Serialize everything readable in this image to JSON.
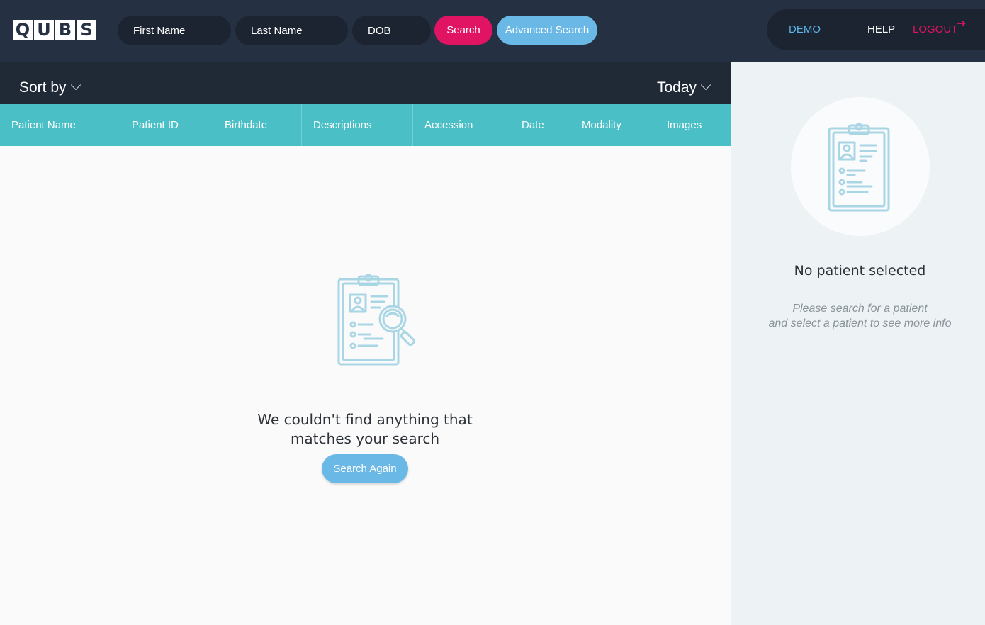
{
  "header": {
    "logo_letters": [
      "Q",
      "U",
      "B",
      "S"
    ],
    "first_name_placeholder": "First Name",
    "last_name_placeholder": "Last Name",
    "dob_placeholder": "DOB",
    "search_label": "Search",
    "advanced_search_label": "Advanced Search",
    "user_label": "DEMO",
    "help_label": "HELP",
    "logout_label": "LOGOUT"
  },
  "sortbar": {
    "sort_label": "Sort by",
    "range_label": "Today"
  },
  "table": {
    "columns": [
      "Patient Name",
      "Patient ID",
      "Birthdate",
      "Descriptions",
      "Accession",
      "Date",
      "Modality",
      "Images"
    ]
  },
  "empty_state": {
    "message_line1": "We couldn't find anything that",
    "message_line2": "matches your search",
    "search_again_label": "Search Again"
  },
  "side_panel": {
    "title": "No patient selected",
    "desc_line1": "Please search for a patient",
    "desc_line2": "and select a patient to see more info"
  },
  "colors": {
    "topbar": "#253142",
    "accent_pink": "#e01463",
    "accent_blue": "#6ab8e6",
    "table_header": "#4bbfc6",
    "icon_stroke": "#a9d6e5"
  },
  "icons": {
    "empty_state": "clipboard-search-icon",
    "side_panel": "clipboard-patient-icon",
    "logout": "arrow-right-icon",
    "dropdown": "chevron-down-icon"
  }
}
